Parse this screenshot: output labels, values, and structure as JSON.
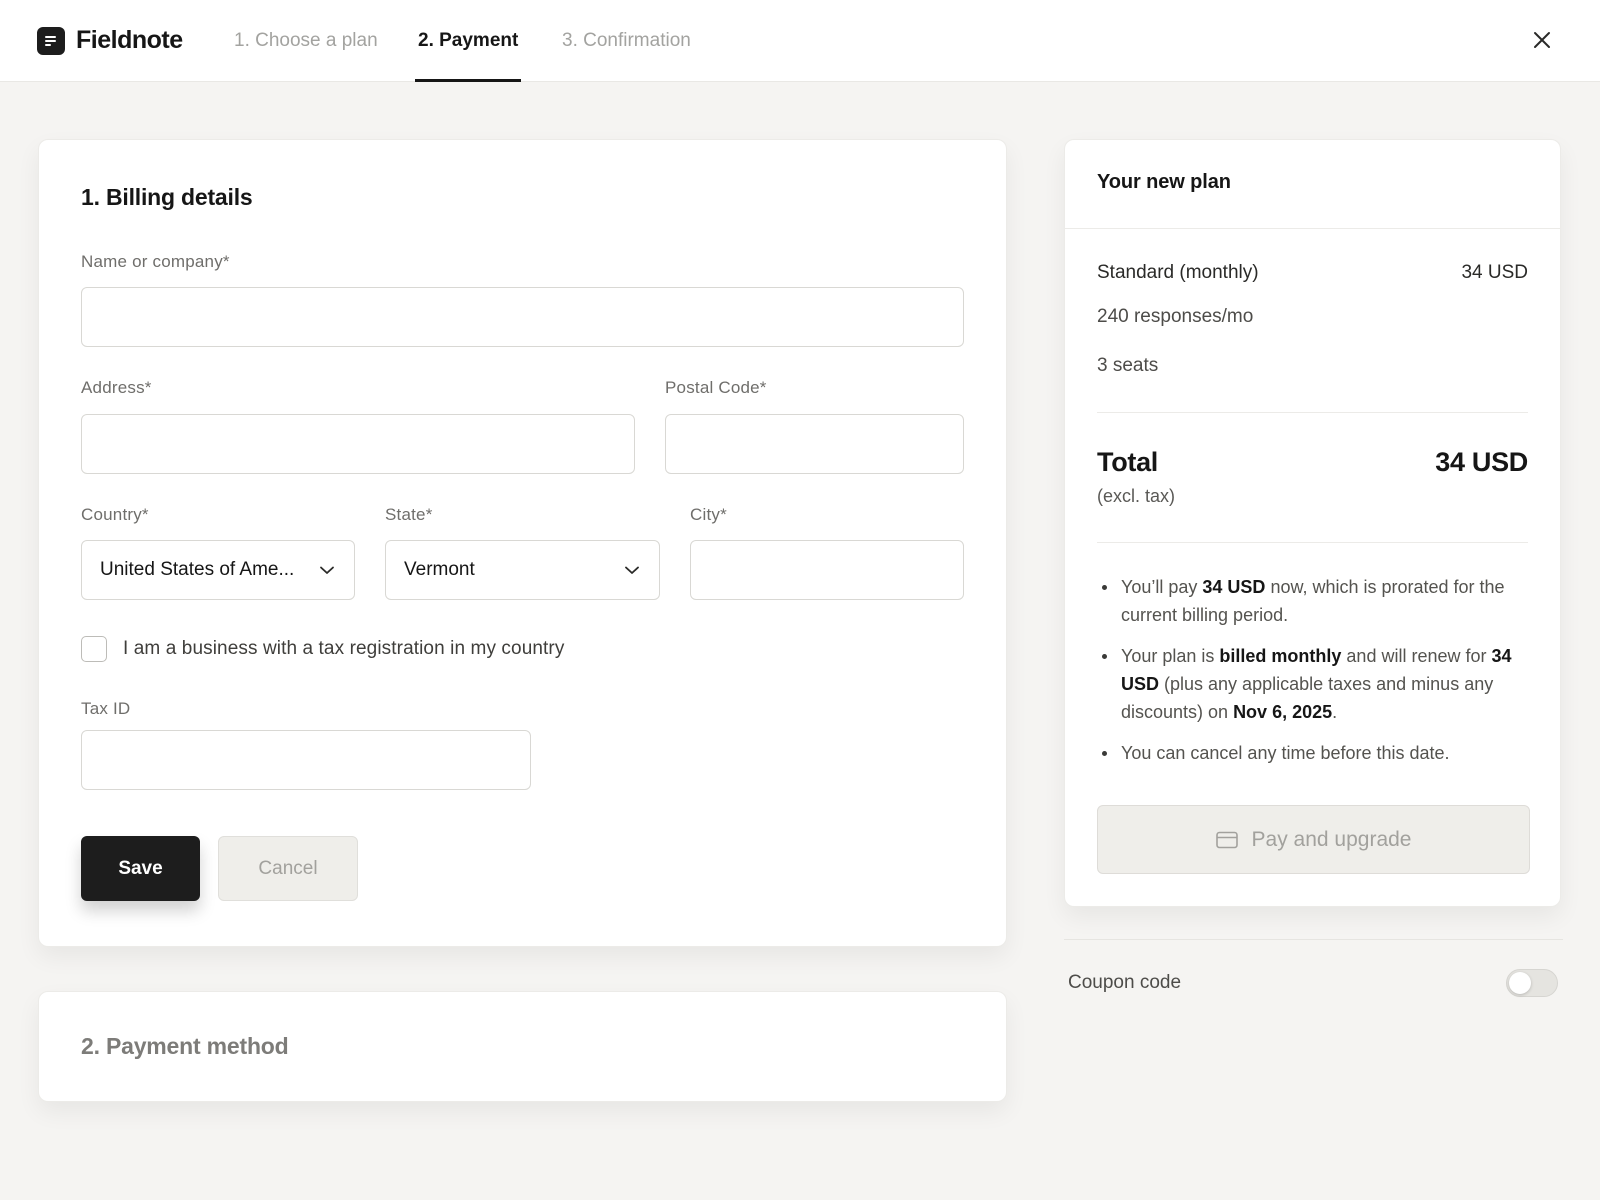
{
  "brand": {
    "name": "Fieldnote",
    "icon": "notebook-logo-icon"
  },
  "steps": [
    {
      "label": "1. Choose a plan",
      "state": "done"
    },
    {
      "label": "2. Payment",
      "state": "active"
    },
    {
      "label": "3. Confirmation",
      "state": "upcoming"
    }
  ],
  "billing": {
    "title": "1. Billing details",
    "name_label": "Name or company*",
    "name_value": "",
    "address_label": "Address*",
    "address_value": "",
    "postal_label": "Postal Code*",
    "postal_value": "",
    "country_label": "Country*",
    "country_value": "United States of Ame...",
    "state_label": "State*",
    "state_value": "Vermont",
    "city_label": "City*",
    "city_value": "",
    "business_checkbox_label": "I am a business with a tax registration in my country",
    "business_checked": false,
    "tax_label": "Tax ID",
    "tax_value": "",
    "save_label": "Save",
    "cancel_label": "Cancel"
  },
  "payment_method": {
    "title": "2. Payment method"
  },
  "plan": {
    "header": "Your new plan",
    "plan_name": "Standard (monthly)",
    "plan_price": "34 USD",
    "responses": "240 responses/mo",
    "seats": "3 seats",
    "total_label": "Total",
    "total_value": "34 USD",
    "total_sub": "(excl. tax)",
    "notes": {
      "n1_a": "You’ll pay ",
      "n1_b": "34 USD",
      "n1_c": " now, which is prorated for the current billing period.",
      "n2_a": "Your plan is ",
      "n2_b": "billed monthly",
      "n2_c": " and will renew for ",
      "n2_d": "34 USD",
      "n2_e": " (plus any applicable taxes and minus any discounts) on ",
      "n2_f": "Nov 6, 2025",
      "n2_g": ".",
      "n3": "You can cancel any time before this date."
    },
    "pay_label": "Pay and upgrade"
  },
  "coupon": {
    "label": "Coupon code",
    "enabled": false
  }
}
